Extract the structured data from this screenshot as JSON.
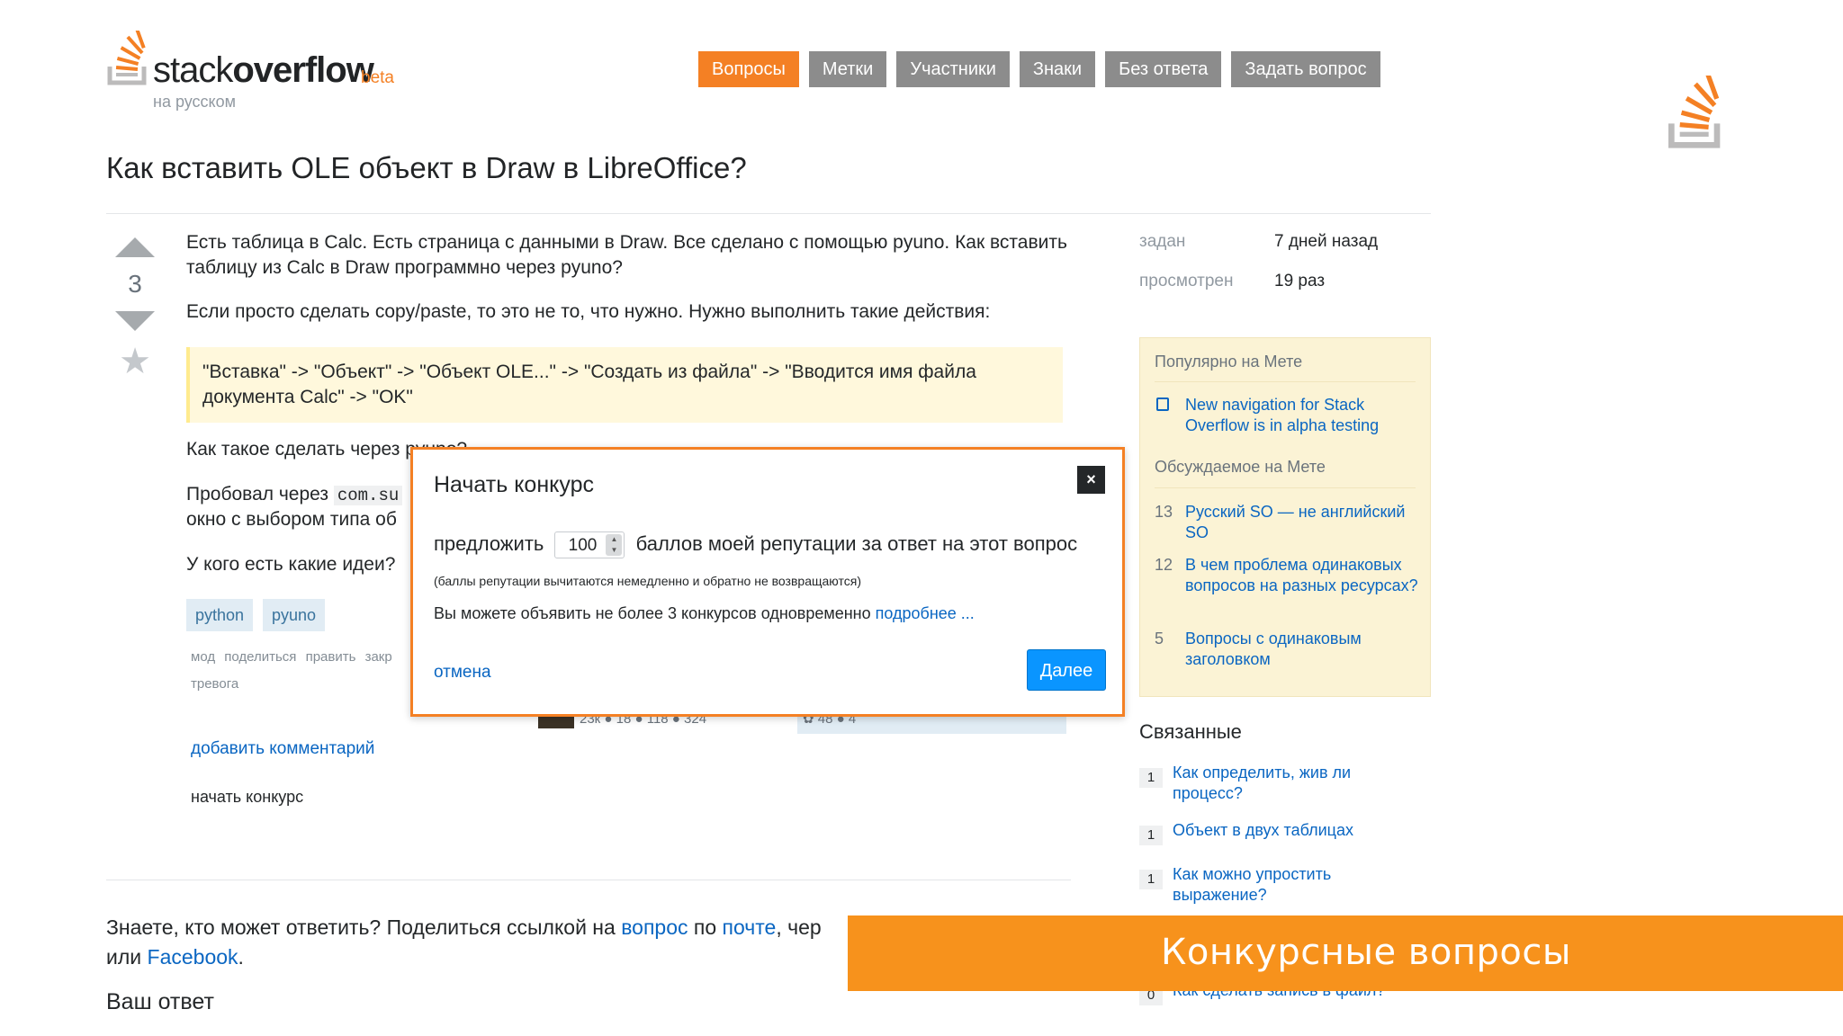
{
  "header": {
    "logo_word_light": "stack",
    "logo_word_bold": "overflow",
    "logo_beta": "beta",
    "logo_sub": "на русском",
    "nav": [
      "Вопросы",
      "Метки",
      "Участники",
      "Знаки",
      "Без ответа",
      "Задать вопрос"
    ],
    "active_nav": 0
  },
  "question": {
    "title": "Как вставить OLE объект в Draw в LibreOffice?",
    "votes": "3",
    "para1": "Есть таблица в Calc. Есть страница с данными в Draw. Все сделано с помощью pyuno. Как вставить таблицу из Calc в Draw программно через pyuno?",
    "para2": "Если просто сделать copy/paste, то это не то, что нужно. Нужно выполнить такие действия:",
    "quote": "\"Вставка\" -> \"Объект\" -> \"Объект OLE...\" -> \"Создать из файла\" -> \"Вводится имя файла документа Calc\" -> \"OK\"",
    "para3": "Как такое сделать через pyuno?",
    "para4_start": "Пробовал через",
    "para4_code": "com.su",
    "para4_line2": "окно с выбором типа об",
    "para5": "У кого есть какие идеи?",
    "tags": [
      "python",
      "pyuno"
    ],
    "menu": "мод поделиться править закр",
    "menu2": "тревога",
    "usercard1": "23к ● 18 ● 118 ● 324",
    "usercard2": "✿ 48 ● 4",
    "add_comment": "добавить комментарий",
    "start_bounty": "начать конкурс"
  },
  "share": {
    "text1": "Знаете, кто может ответить? Поделиться ссылкой на ",
    "link1": "вопрос",
    "text2": " по ",
    "link2": "почте",
    "text3": ", чер",
    "text4": "или ",
    "link3": "Facebook",
    "text5": ".",
    "your_answer": "Ваш ответ"
  },
  "sidebar": {
    "asked_label": "задан",
    "asked_value": "7 дней назад",
    "viewed_label": "просмотрен",
    "viewed_value": "19 раз",
    "popular_head": "Популярно на Мете",
    "popular_item": "New navigation for Stack Overflow is in alpha testing",
    "discussed_head": "Обсуждаемое на Мете",
    "discussed": [
      {
        "num": "13",
        "text": "Русский SO — не английский SO"
      },
      {
        "num": "12",
        "text": "В чем проблема одинаковых вопросов на разных ресурсах?"
      },
      {
        "num": "5",
        "text": "Вопросы с одинаковым заголовком"
      }
    ],
    "related_head": "Связанные",
    "related": [
      {
        "num": "1",
        "text": "Как определить, жив ли процесс?"
      },
      {
        "num": "1",
        "text": "Объект в двух таблицах"
      },
      {
        "num": "1",
        "text": "Как можно упростить выражение?"
      },
      {
        "num": "0",
        "text": "Как сделать запись в файл?"
      }
    ]
  },
  "modal": {
    "title": "Начать конкурс",
    "close": "×",
    "offer_before": "предложить",
    "amount": "100",
    "offer_after": "баллов моей репутации за ответ на этот вопрос",
    "note": "(баллы репутации вычитаются немедленно и обратно не возвращаются)",
    "limit_text": "Вы можете объявить не более 3 конкурсов одновременно ",
    "limit_link": "подробнее ...",
    "cancel": "отмена",
    "next": "Далее"
  },
  "banner": {
    "text": "Конкурсные вопросы"
  },
  "colors": {
    "accent": "#f48024",
    "link": "#0a66c2",
    "button": "#0a95ff",
    "banner": "#f7921c"
  }
}
